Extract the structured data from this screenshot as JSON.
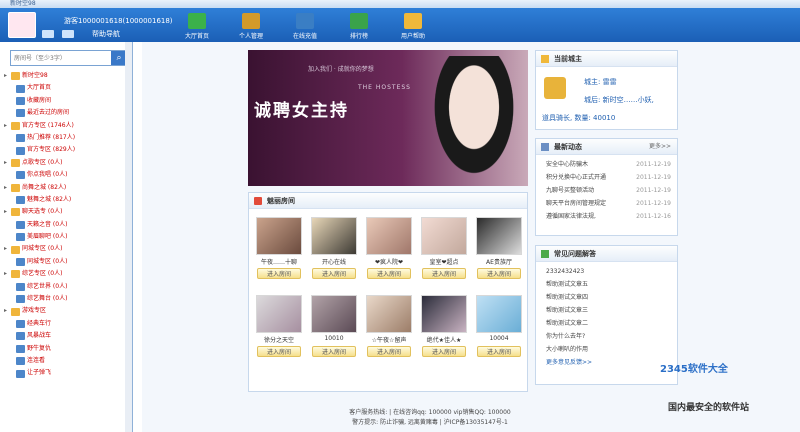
{
  "window_title": "新时空98",
  "user": {
    "name": "游客1000001618(1000001618)",
    "help_link": "帮助导航"
  },
  "nav": [
    {
      "label": "大厅首页",
      "color": "#3bb14a"
    },
    {
      "label": "个人管理",
      "color": "#d39a2a"
    },
    {
      "label": "在线充值",
      "color": "#3a7ec4"
    },
    {
      "label": "排行榜",
      "color": "#3aa34a"
    },
    {
      "label": "用户帮助",
      "color": "#f0b83a"
    }
  ],
  "search": {
    "placeholder": "房间号（至少3字）"
  },
  "tree": [
    {
      "label": "新时空98",
      "level": 0
    },
    {
      "label": "大厅首页",
      "level": 1
    },
    {
      "label": "收藏房间",
      "level": 1
    },
    {
      "label": "最近去过的房间",
      "level": 1
    },
    {
      "label": "官方专区  (1746人)",
      "level": 0
    },
    {
      "label": "热门推荐  (817人)",
      "level": 1
    },
    {
      "label": "官方专区  (829人)",
      "level": 1
    },
    {
      "label": "点歌专区  (0人)",
      "level": 0
    },
    {
      "label": "你点我唱  (0人)",
      "level": 1
    },
    {
      "label": "尚舞之城  (82人)",
      "level": 0
    },
    {
      "label": "魅舞之城  (82人)",
      "level": 1
    },
    {
      "label": "聊天选专  (0人)",
      "level": 0
    },
    {
      "label": "天籁之音  (0人)",
      "level": 1
    },
    {
      "label": "美眉聊吧  (0人)",
      "level": 1
    },
    {
      "label": "同城专区  (0人)",
      "level": 0
    },
    {
      "label": "同城专区  (0人)",
      "level": 1
    },
    {
      "label": "综艺专区  (0人)",
      "level": 0
    },
    {
      "label": "综艺世界  (0人)",
      "level": 1
    },
    {
      "label": "综艺舞台  (0人)",
      "level": 1
    },
    {
      "label": "游戏专区",
      "level": 0
    },
    {
      "label": "经典车行",
      "level": 1
    },
    {
      "label": "风暴战车",
      "level": 1
    },
    {
      "label": "野牛复仇",
      "level": 1
    },
    {
      "label": "连连看",
      "level": 1
    },
    {
      "label": "让子弹飞",
      "level": 1
    }
  ],
  "banner": {
    "headline": "诚聘女主持",
    "subline": "THE HOSTESS",
    "small": "加入我们 · 成就你的梦想"
  },
  "rooms_panel": {
    "title": "魅丽房间"
  },
  "rooms": [
    {
      "name": "午夜……十聊",
      "enter": "进入房间",
      "c1": "#caa38c",
      "c2": "#6b4b3e"
    },
    {
      "name": "开心在线",
      "enter": "进入房间",
      "c1": "#e8d7b8",
      "c2": "#3d3a34"
    },
    {
      "name": "❤疯人院❤",
      "enter": "进入房间",
      "c1": "#e9c9b8",
      "c2": "#a0776a"
    },
    {
      "name": "皇室❤超点",
      "enter": "进入房间",
      "c1": "#f2dbd3",
      "c2": "#c2a89c"
    },
    {
      "name": "AE贵族厅",
      "enter": "进入房间",
      "c1": "#2a2a2a",
      "c2": "#dddddd"
    },
    {
      "name": "徐分之天空",
      "enter": "进入房间",
      "c1": "#dcdadc",
      "c2": "#a68fa0"
    },
    {
      "name": "10010",
      "enter": "进入房间",
      "c1": "#b2a3a8",
      "c2": "#5b4a55"
    },
    {
      "name": "☆午夜☆留声",
      "enter": "进入房间",
      "c1": "#e9d8c9",
      "c2": "#9c7d68"
    },
    {
      "name": "绝代★佳人★",
      "enter": "进入房间",
      "c1": "#2b2c3a",
      "c2": "#c9b3c2"
    },
    {
      "name": "10004",
      "enter": "进入房间",
      "c1": "#bfe0f4",
      "c2": "#6aaed6"
    }
  ],
  "owner_panel": {
    "title": "当前城主",
    "line1": "城主: 雷雷",
    "line2": "城后: 新时空……小妖,",
    "line3": "道具骑长, 数量: 40010"
  },
  "news_panel": {
    "title": "最新动态",
    "more": "更多>>",
    "items": [
      {
        "text": "安全中心防骗木",
        "date": "2011-12-19"
      },
      {
        "text": "积分兑换中心正式开通",
        "date": "2011-12-19"
      },
      {
        "text": "九聊号买整顿活动",
        "date": "2011-12-19"
      },
      {
        "text": "聊天平台房间管理规定",
        "date": "2011-12-19"
      },
      {
        "text": "遵循国家法律法规,",
        "date": "2011-12-16"
      }
    ]
  },
  "faq_panel": {
    "title": "常见问题解答",
    "items": [
      "2332432423",
      "帮助测试文章五",
      "帮助测试文章四",
      "帮助测试文章三",
      "帮助测试文章二",
      "你为什么去年?",
      "大小喇叭的作用"
    ],
    "more": "更多意见反馈>>"
  },
  "footer": {
    "line1": "客户服务热线: | 在线咨询qq: 100000  vip销售QQ: 100000",
    "line2": "警方提示: 防止诈骗, 远离黄赌毒 | 沪ICP备13035147号-1"
  },
  "watermark": {
    "brand": "2345软件大全",
    "sub": "国内最安全的软件站"
  }
}
